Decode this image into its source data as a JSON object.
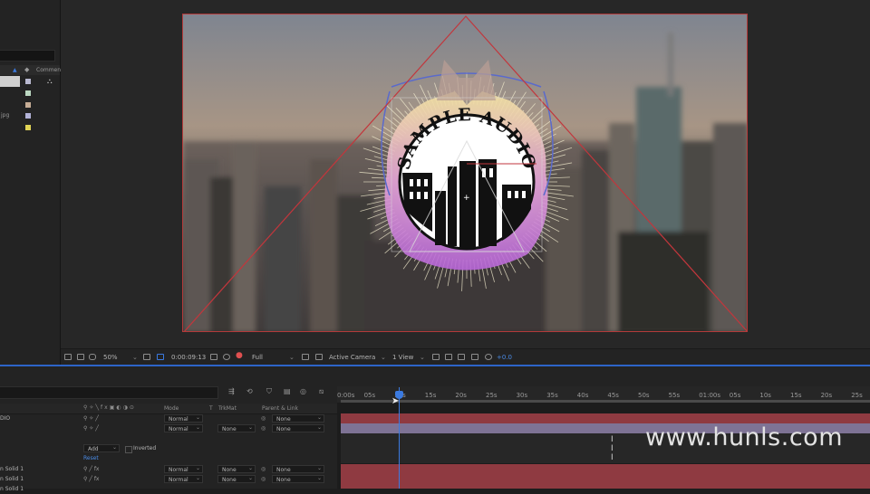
{
  "project": {
    "column_comment": "Commen",
    "items": [
      {
        "label": "",
        "color": "#b9b9d0"
      },
      {
        "label": "",
        "color": "#bcd8c2"
      },
      {
        "label": "",
        "color": "#c7ad96"
      },
      {
        "label": "jpg",
        "color": "#b3b3d8"
      },
      {
        "label": "",
        "color": "#e0d455"
      }
    ]
  },
  "composition": {
    "logo_text": "SAMPLE AUDIO"
  },
  "viewer_toolbar": {
    "zoom": "50%",
    "timecode": "0:00:09:13",
    "resolution": "Full",
    "camera": "Active Camera",
    "views": "1 View",
    "exposure": "+0.0"
  },
  "timeline": {
    "columns": {
      "mode": "Mode",
      "t": "T",
      "trkmat": "TrkMat",
      "parent": "Parent & Link"
    },
    "layers": [
      {
        "name": "DIO",
        "mode": "Normal",
        "trkmat": "",
        "parent": "None"
      },
      {
        "name": "",
        "mode": "Normal",
        "trkmat": "None",
        "parent": "None"
      }
    ],
    "mask": {
      "mode": "Add",
      "inverted_label": "Inverted",
      "reset_label": "Reset"
    },
    "solids": [
      {
        "name": "n Solid 1",
        "mode": "Normal",
        "trkmat": "None",
        "parent": "None"
      },
      {
        "name": "n Solid 1",
        "mode": "Normal",
        "trkmat": "None",
        "parent": "None"
      },
      {
        "name": "n Solid 1",
        "mode": "",
        "trkmat": "",
        "parent": ""
      }
    ],
    "ruler_ticks": [
      "0:00s",
      "05s",
      "10s",
      "15s",
      "20s",
      "25s",
      "30s",
      "35s",
      "40s",
      "45s",
      "50s",
      "55s",
      "01:00s",
      "05s",
      "10s",
      "15s",
      "20s",
      "25s"
    ]
  },
  "watermark": "www.hunls.com",
  "colors": {
    "track_red": "#8f3a41",
    "track_purple": "#7e7395",
    "playhead": "#3b7ae0",
    "comp_border": "#b33a3a"
  }
}
